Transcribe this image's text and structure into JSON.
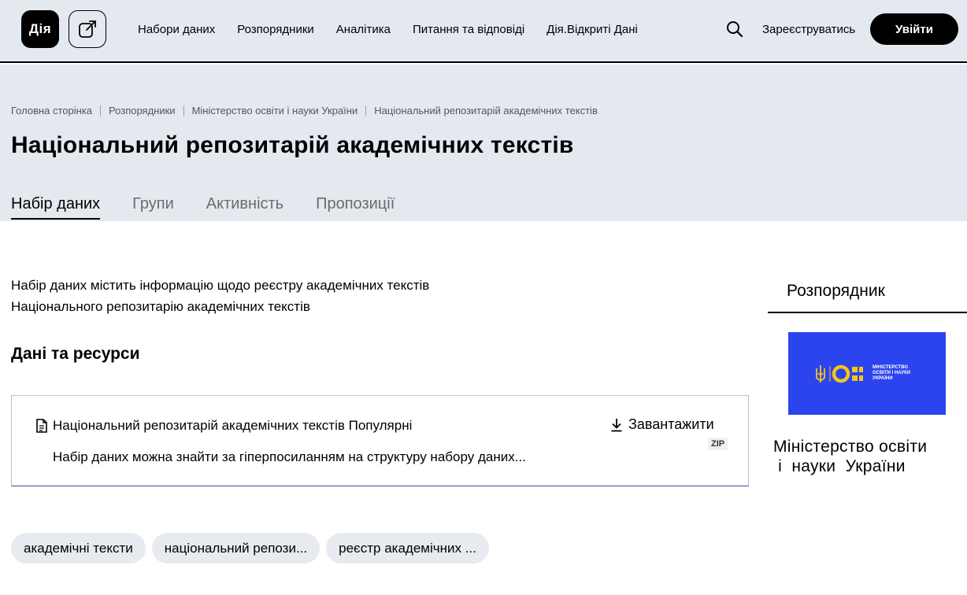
{
  "header": {
    "logo_text": "Дія",
    "nav": [
      "Набори даних",
      "Розпорядники",
      "Аналітика",
      "Питання та відповіді",
      "Дія.Відкриті Дані"
    ],
    "register_label": "Зареєструватись",
    "login_label": "Увійти"
  },
  "breadcrumb": [
    "Головна сторінка",
    "Розпорядники",
    "Міністерство освіти і науки України",
    "Національний репозитарій академічних текстів"
  ],
  "page": {
    "title": "Національний репозитарій академічних текстів",
    "tabs": [
      "Набір даних",
      "Групи",
      "Активність",
      "Пропозиції"
    ],
    "active_tab": "Набір даних"
  },
  "main": {
    "description_line1": "Набір даних містить інформацію щодо реєстру академічних текстів",
    "description_line2": "Національного репозитарію академічних  текстів",
    "resources_title": "Дані та ресурси",
    "resource": {
      "title": "Національний репозитарій академічних текстів Популярні",
      "download_label": "Завантажити",
      "format": "ZIP",
      "description": "Набір даних можна знайти за гіперпосиланням на структуру набору даних..."
    },
    "tags": [
      "академічні тексти",
      "національний репози...",
      "реєстр академічних ..."
    ]
  },
  "sidebar": {
    "title": "Розпорядник",
    "logo_text": "МІНІСТЕРСТВО ОСВІТИ І НАУКИ УКРАЇНИ",
    "org_name_line1": "Міністерство освіти",
    "org_name_line2": " і  науки  України"
  },
  "colors": {
    "header_bg": "#e3e9ef",
    "accent_black": "#000000",
    "org_logo_bg": "#2b44ee",
    "org_logo_yellow": "#f5c518"
  }
}
